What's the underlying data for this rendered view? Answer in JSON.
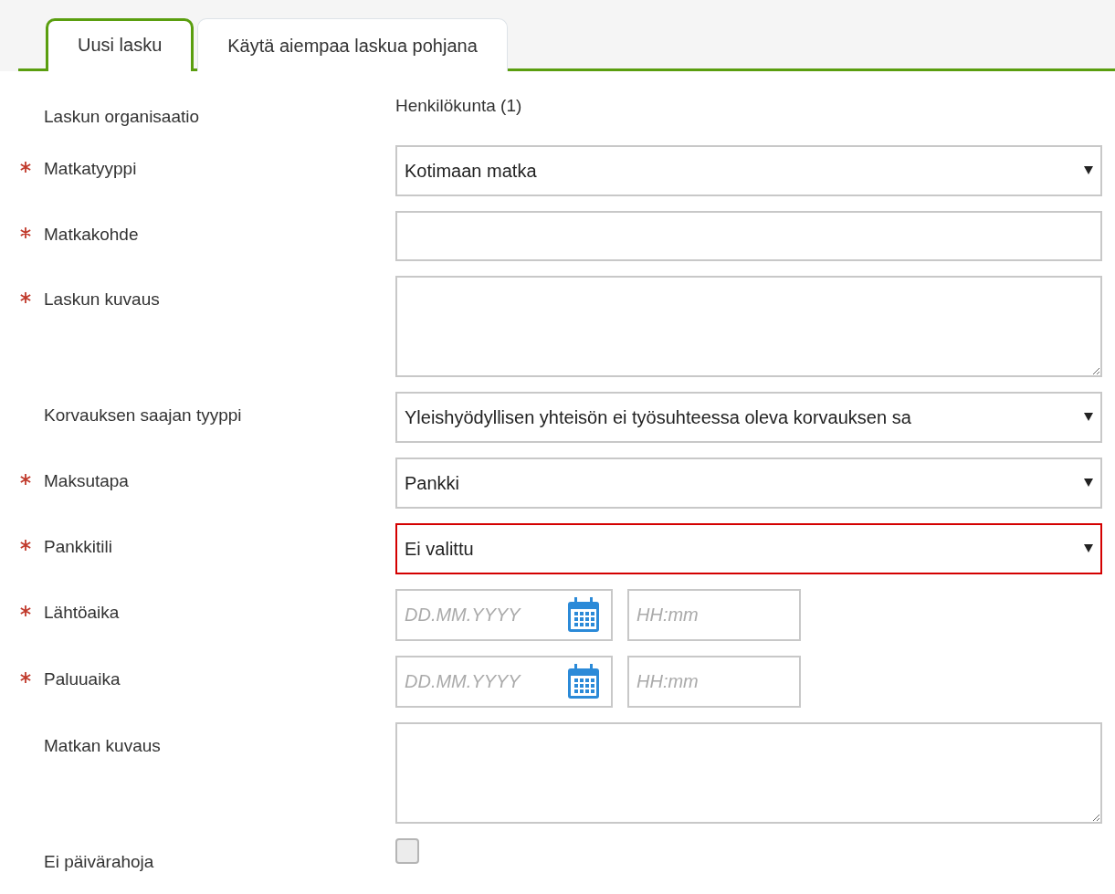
{
  "tabs": [
    {
      "label": "Uusi lasku",
      "selected": true
    },
    {
      "label": "Käytä aiempaa laskua pohjana",
      "selected": false
    }
  ],
  "fields": [
    {
      "kind": "static",
      "label": "Laskun organisaatio",
      "required": false,
      "value": "Henkilökunta (1)"
    },
    {
      "kind": "select",
      "label": "Matkatyyppi",
      "required": true,
      "value": "Kotimaan matka",
      "invalid": false
    },
    {
      "kind": "text",
      "label": "Matkakohde",
      "required": true
    },
    {
      "kind": "textarea",
      "label": "Laskun kuvaus",
      "required": true
    },
    {
      "kind": "select",
      "label": "Korvauksen saajan tyyppi",
      "required": false,
      "value": "Yleishyödyllisen yhteisön ei työsuhteessa oleva korvauksen sa",
      "invalid": false
    },
    {
      "kind": "select",
      "label": "Maksutapa",
      "required": true,
      "value": "Pankki",
      "invalid": false
    },
    {
      "kind": "select",
      "label": "Pankkitili",
      "required": true,
      "value": "Ei valittu",
      "invalid": true
    },
    {
      "kind": "datetime",
      "label": "Lähtöaika",
      "required": true,
      "date_placeholder": "DD.MM.YYYY",
      "time_placeholder": "HH:mm"
    },
    {
      "kind": "datetime",
      "label": "Paluuaika",
      "required": true,
      "date_placeholder": "DD.MM.YYYY",
      "time_placeholder": "HH:mm"
    },
    {
      "kind": "textarea",
      "label": "Matkan kuvaus",
      "required": false
    },
    {
      "kind": "checkbox",
      "label": "Ei päivärahoja",
      "required": false,
      "checked": false
    }
  ]
}
